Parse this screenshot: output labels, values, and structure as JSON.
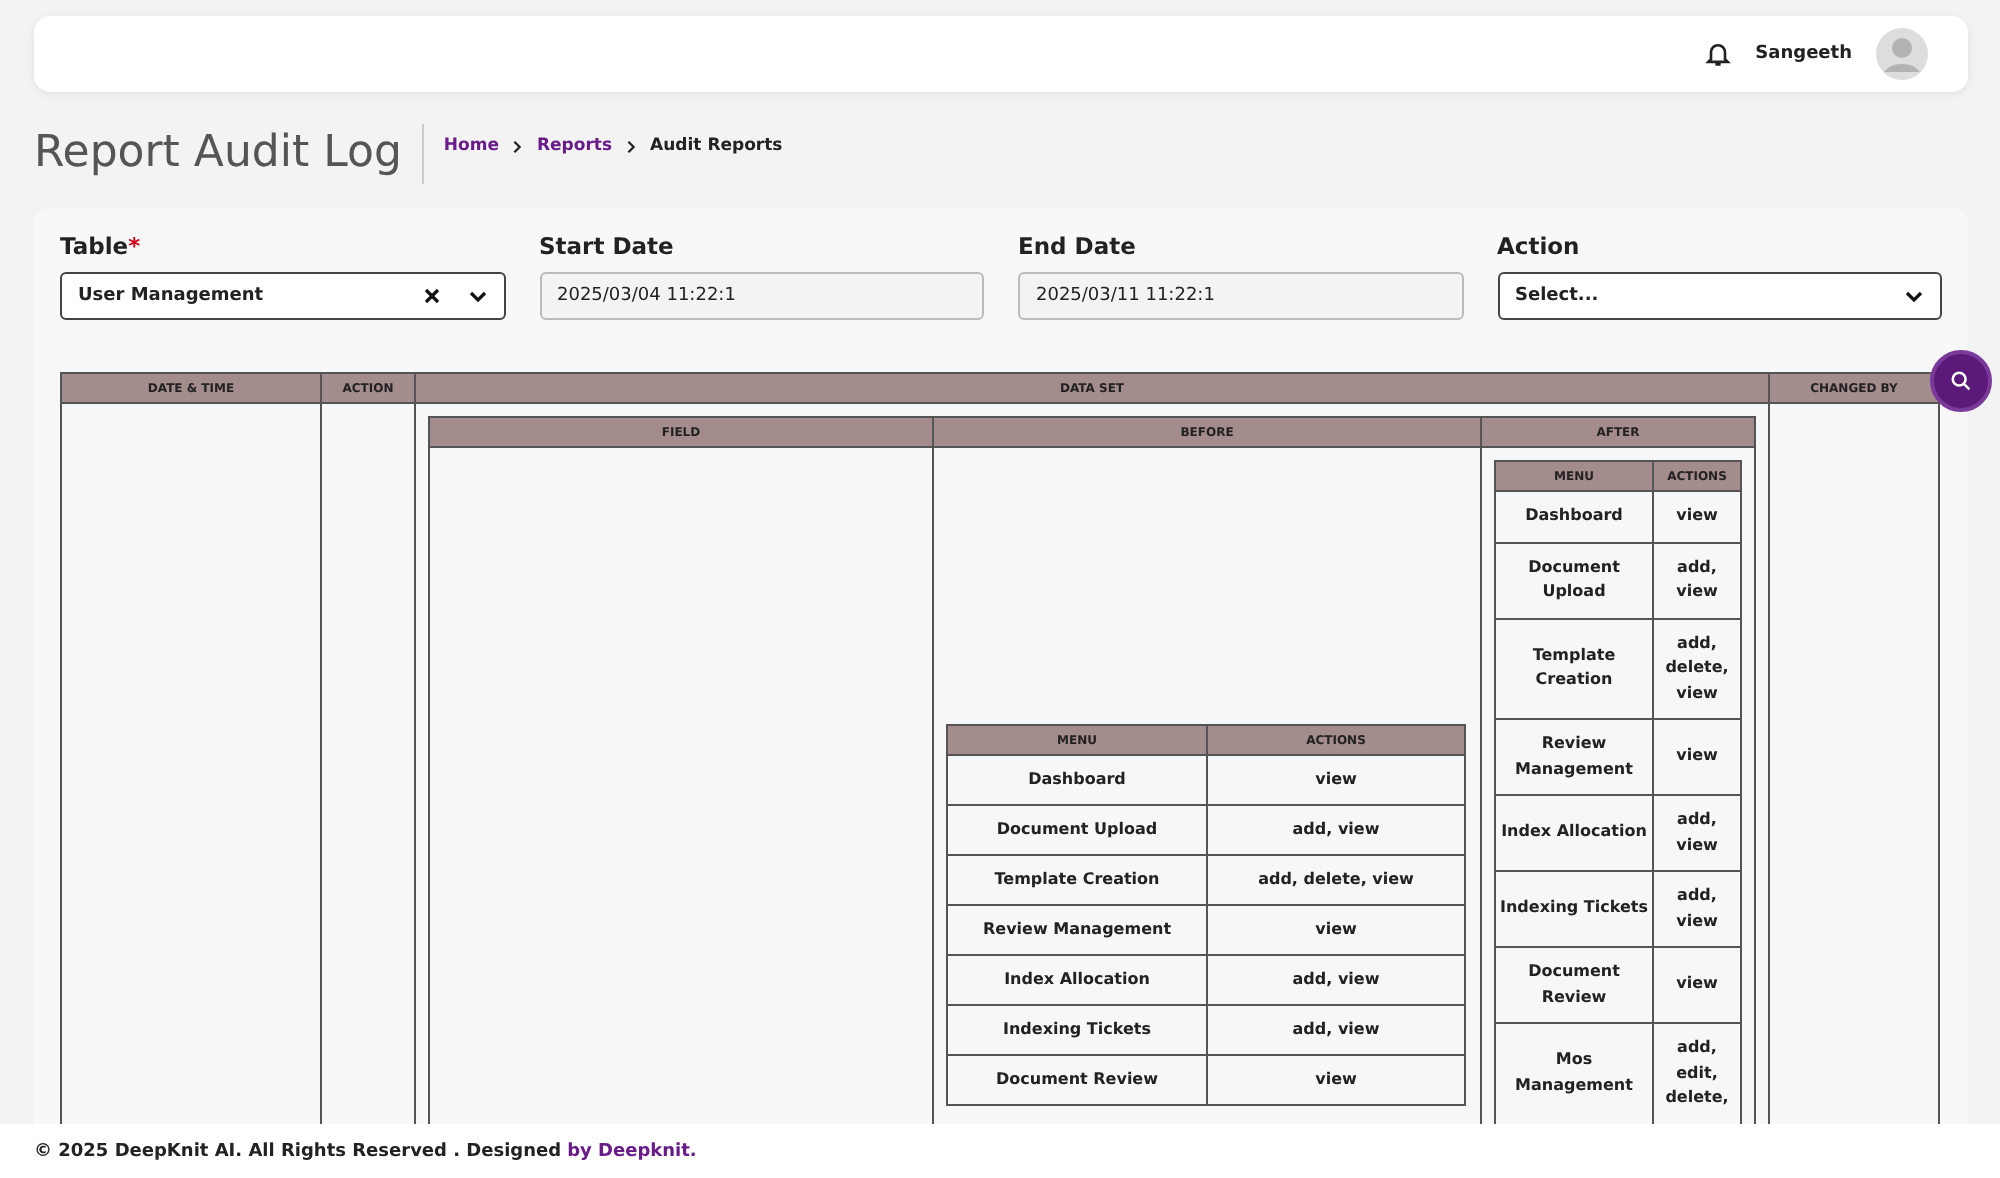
{
  "header": {
    "user_name": "Sangeeth"
  },
  "page_title": "Report Audit Log",
  "breadcrumbs": [
    {
      "label": "Home",
      "current": false
    },
    {
      "label": "Reports",
      "current": false
    },
    {
      "label": "Audit Reports",
      "current": true
    }
  ],
  "filters": [
    {
      "kind": "select",
      "label": "Table",
      "required_mark": "*",
      "value": "User Management",
      "clearable": true
    },
    {
      "kind": "date",
      "label": "Start Date",
      "value": "2025/03/04 11:22:1"
    },
    {
      "kind": "date",
      "label": "End Date",
      "value": "2025/03/11 11:22:1"
    },
    {
      "kind": "select",
      "label": "Action",
      "placeholder": "Select...",
      "clearable": false
    }
  ],
  "table": {
    "columns": [
      "DATE & TIME",
      "ACTION",
      "DATA SET",
      "CHANGED BY"
    ],
    "data_set_columns": [
      "FIELD",
      "BEFORE",
      "AFTER"
    ],
    "before": {
      "columns": [
        "MENU",
        "ACTIONS"
      ],
      "rows": [
        [
          "Dashboard",
          "view"
        ],
        [
          "Document Upload",
          "add, view"
        ],
        [
          "Template Creation",
          "add, delete, view"
        ],
        [
          "Review Management",
          "view"
        ],
        [
          "Index Allocation",
          "add, view"
        ],
        [
          "Indexing Tickets",
          "add, view"
        ],
        [
          "Document Review",
          "view"
        ]
      ]
    },
    "after": {
      "columns": [
        "MENU",
        "ACTIONS"
      ],
      "rows": [
        [
          "Dashboard",
          "view"
        ],
        [
          "Document Upload",
          "add, view"
        ],
        [
          "Template Creation",
          "add, delete, view"
        ],
        [
          "Review Management",
          "view"
        ],
        [
          "Index Allocation",
          "add, view"
        ],
        [
          "Indexing Tickets",
          "add, view"
        ],
        [
          "Document Review",
          "view"
        ],
        [
          "Mos Management",
          "add, edit, delete,"
        ]
      ]
    }
  },
  "footer": {
    "text": "© 2025 DeepKnit AI. All Rights Reserved . Designed",
    "link": "by Deepknit."
  }
}
